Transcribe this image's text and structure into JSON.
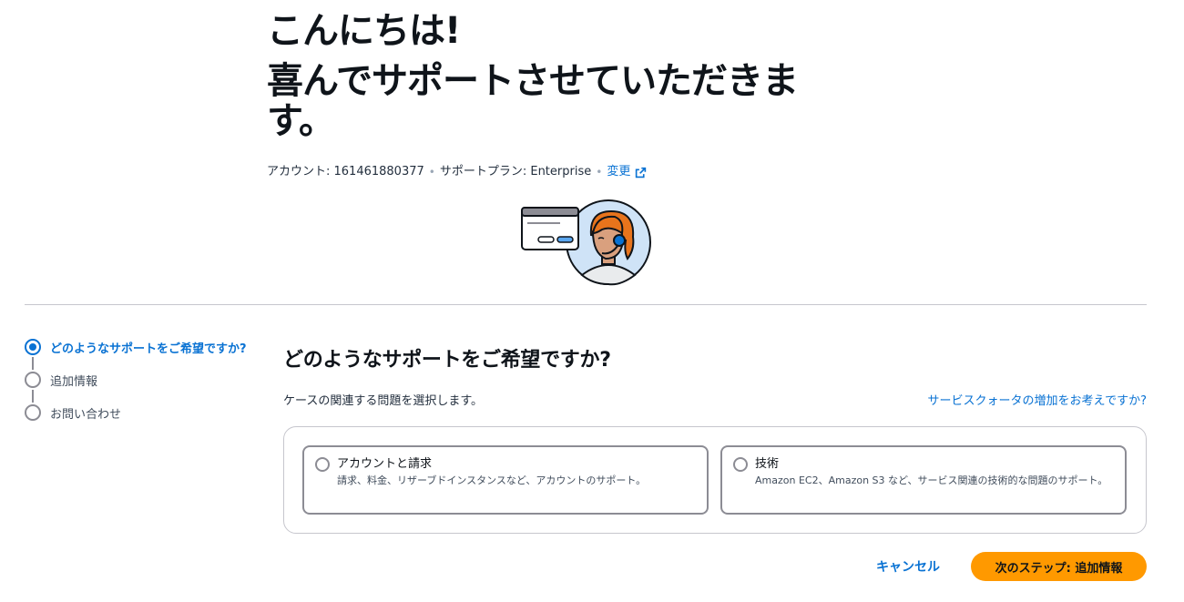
{
  "header": {
    "greeting": "こんにちは!",
    "subtitle": "喜んでサポートさせていただきます。"
  },
  "meta": {
    "account": "アカウント: 161461880377",
    "plan": "サポートプラン: Enterprise",
    "change_link": "変更"
  },
  "steps": [
    {
      "label": "どのようなサポートをご希望ですか?",
      "active": true
    },
    {
      "label": "追加情報",
      "active": false
    },
    {
      "label": "お問い合わせ",
      "active": false
    }
  ],
  "main": {
    "title": "どのようなサポートをご希望ですか?",
    "description": "ケースの関連する問題を選択します。",
    "quota_link": "サービスクォータの増加をお考えですか?",
    "options": [
      {
        "label": "アカウントと請求",
        "description": "請求、料金、リザーブドインスタンスなど、アカウントのサポート。"
      },
      {
        "label": "技術",
        "description": "Amazon EC2、Amazon S3 など、サービス関連の技術的な問題のサポート。"
      }
    ]
  },
  "footer": {
    "cancel": "キャンセル",
    "next": "次のステップ: 追加情報"
  },
  "colors": {
    "link": "#0972d3",
    "primary_button": "#ff9900",
    "illustration_hair": "#e8741c",
    "illustration_bg": "#cfe3f7"
  },
  "icons": [
    "external-link-icon",
    "support-agent-illustration"
  ]
}
